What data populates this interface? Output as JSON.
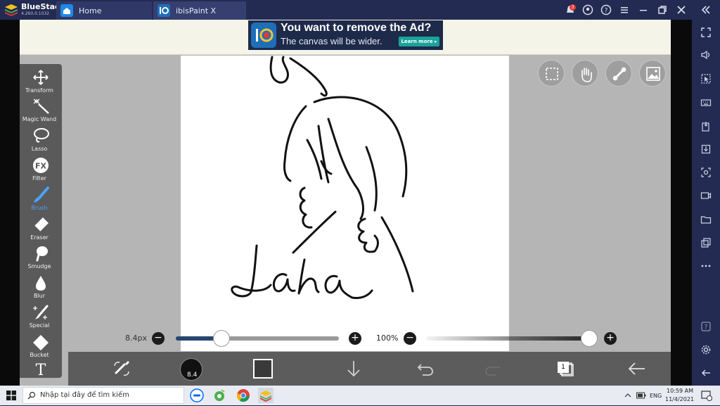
{
  "titlebar": {
    "app_name": "BlueStacks",
    "version": "4.260.0.1032",
    "tabs": [
      {
        "label": "Home"
      },
      {
        "label": "ibisPaint X"
      }
    ],
    "notification_count": "3"
  },
  "ad": {
    "title": "You want to remove the Ad?",
    "subtitle": "The canvas will be wider.",
    "cta": "Learn more ▸"
  },
  "tools": [
    {
      "label": "Transform",
      "icon": "transform-icon"
    },
    {
      "label": "Magic Wand",
      "icon": "magic-wand-icon"
    },
    {
      "label": "Lasso",
      "icon": "lasso-icon"
    },
    {
      "label": "Filter",
      "icon": "fx-icon"
    },
    {
      "label": "Brush",
      "icon": "brush-icon",
      "active": true
    },
    {
      "label": "Eraser",
      "icon": "eraser-icon"
    },
    {
      "label": "Smudge",
      "icon": "smudge-icon"
    },
    {
      "label": "Blur",
      "icon": "blur-icon"
    },
    {
      "label": "Special",
      "icon": "special-icon"
    },
    {
      "label": "Bucket",
      "icon": "bucket-icon"
    },
    {
      "label": "",
      "icon": "text-icon"
    }
  ],
  "brush": {
    "size_label": "8.4px",
    "size_short": "8.4",
    "size_fraction": 0.28,
    "opacity_label": "100%",
    "opacity_fraction": 1.0
  },
  "fx_glyph": "FX",
  "text_glyph": "T",
  "layer_count": "1",
  "taskbar": {
    "search_placeholder": "Nhập tại đây để tìm kiếm",
    "time": "10:59 AM",
    "date": "11/4/2021",
    "language": "ENG"
  },
  "colors": {
    "accent": "#4aa3ff",
    "toolbar": "#5c5c5c",
    "size_fill": "#26466e"
  }
}
